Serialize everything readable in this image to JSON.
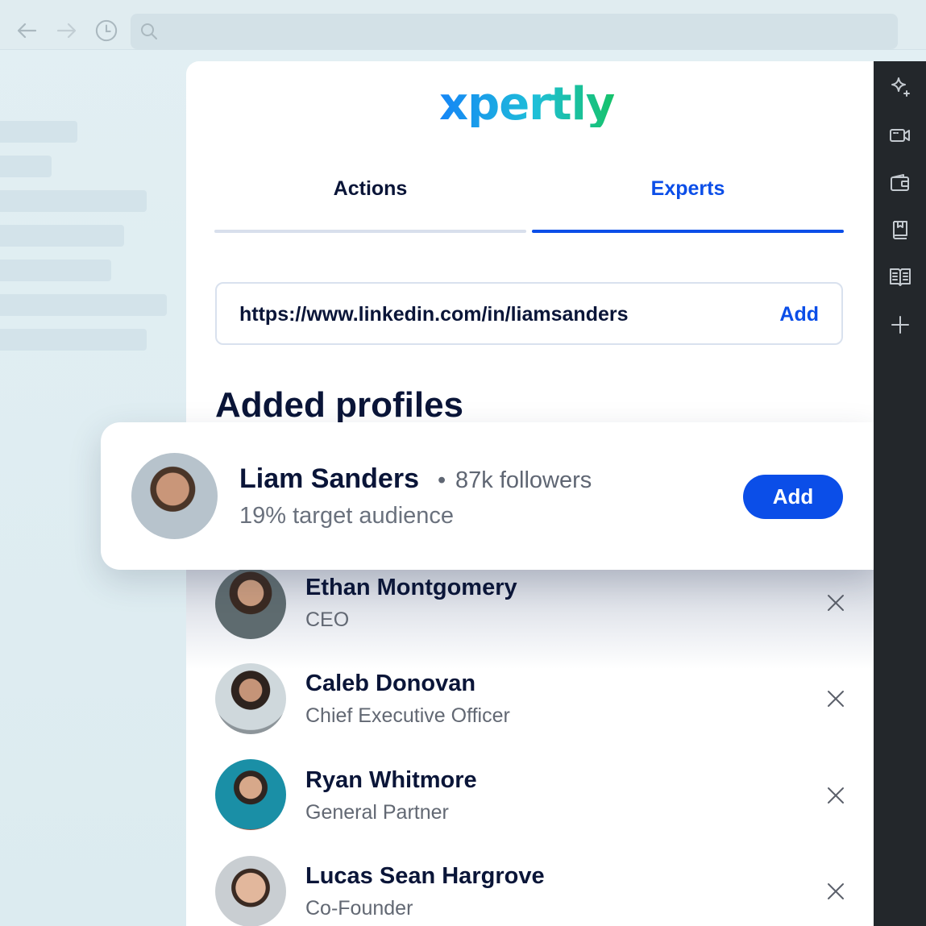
{
  "browser": {
    "back_icon": "arrow-left",
    "forward_icon": "arrow-right",
    "history_icon": "clock",
    "search_icon": "search",
    "address_value": ""
  },
  "extension": {
    "logo_text": "xpertly",
    "tabs": [
      {
        "label": "Actions",
        "active": false
      },
      {
        "label": "Experts",
        "active": true
      }
    ],
    "url_input": {
      "value": "https://www.linkedin.com/in/liamsanders",
      "add_label": "Add"
    },
    "section_title": "Added profiles",
    "preview_card": {
      "name": "Liam Sanders",
      "separator": "•",
      "followers": "87k followers",
      "audience": "19% target audience",
      "add_label": "Add"
    },
    "profiles": [
      {
        "name": "Ethan Montgomery",
        "role": "CEO"
      },
      {
        "name": "Caleb Donovan",
        "role": "Chief Executive Officer"
      },
      {
        "name": "Ryan Whitmore",
        "role": "General Partner"
      },
      {
        "name": "Lucas Sean Hargrove",
        "role": "Co-Founder"
      }
    ]
  },
  "sidebar": {
    "icons": [
      "sparkle",
      "video-camera",
      "wallet",
      "bookmark-book",
      "open-book",
      "plus"
    ]
  },
  "colors": {
    "accent": "#0b4ee8",
    "text_dark": "#0a1538",
    "text_muted": "#626873",
    "sidebar_bg": "#23272b"
  }
}
